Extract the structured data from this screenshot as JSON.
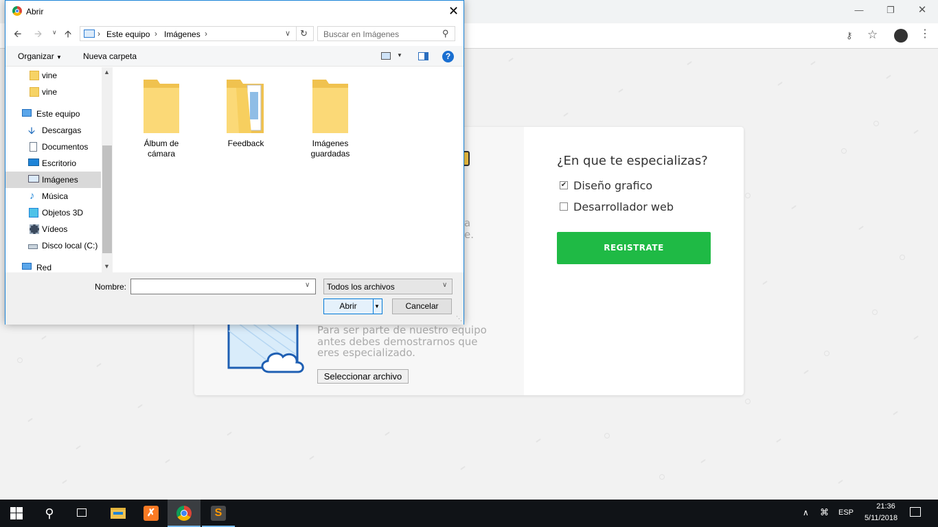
{
  "page": {
    "question": "¿En que te especializas?",
    "options": [
      {
        "label": "Diseño grafico",
        "checked": true
      },
      {
        "label": "Desarrollador web",
        "checked": false
      }
    ],
    "register_label": "REGISTRATE",
    "upload_text": "Para ser parte de nuestro equipo antes debes demostrarnos que eres especializado.",
    "partial_text_1": "a",
    "partial_text_2": "e.",
    "select_file_label": "Seleccionar archivo",
    "accent_color": "#1fba45"
  },
  "dialog": {
    "title": "Abrir",
    "address": {
      "segments": [
        "Este equipo",
        "Imágenes"
      ]
    },
    "search_placeholder": "Buscar en Imágenes",
    "organize_label": "Organizar",
    "new_folder_label": "Nueva carpeta",
    "nav_items": [
      {
        "label": "vine",
        "icon": "folder-icon"
      },
      {
        "label": "vine",
        "icon": "folder-icon"
      },
      {
        "label": "Este equipo",
        "icon": "computer-icon"
      },
      {
        "label": "Descargas",
        "icon": "download-icon"
      },
      {
        "label": "Documentos",
        "icon": "document-icon"
      },
      {
        "label": "Escritorio",
        "icon": "desktop-icon"
      },
      {
        "label": "Imágenes",
        "icon": "pictures-icon",
        "selected": true
      },
      {
        "label": "Música",
        "icon": "music-icon"
      },
      {
        "label": "Objetos 3D",
        "icon": "cube-icon"
      },
      {
        "label": "Vídeos",
        "icon": "video-icon"
      },
      {
        "label": "Disco local (C:)",
        "icon": "drive-icon"
      },
      {
        "label": "Red",
        "icon": "network-icon"
      }
    ],
    "folders": [
      {
        "line1": "Álbum de",
        "line2": "cámara"
      },
      {
        "line1": "Feedback",
        "line2": ""
      },
      {
        "line1": "Imágenes",
        "line2": "guardadas"
      }
    ],
    "filename_label": "Nombre:",
    "filename_value": "",
    "filter_value": "Todos los archivos",
    "open_label": "Abrir",
    "cancel_label": "Cancelar"
  },
  "taskbar": {
    "language": "ESP",
    "time": "21:36",
    "date": "5/11/2018"
  }
}
